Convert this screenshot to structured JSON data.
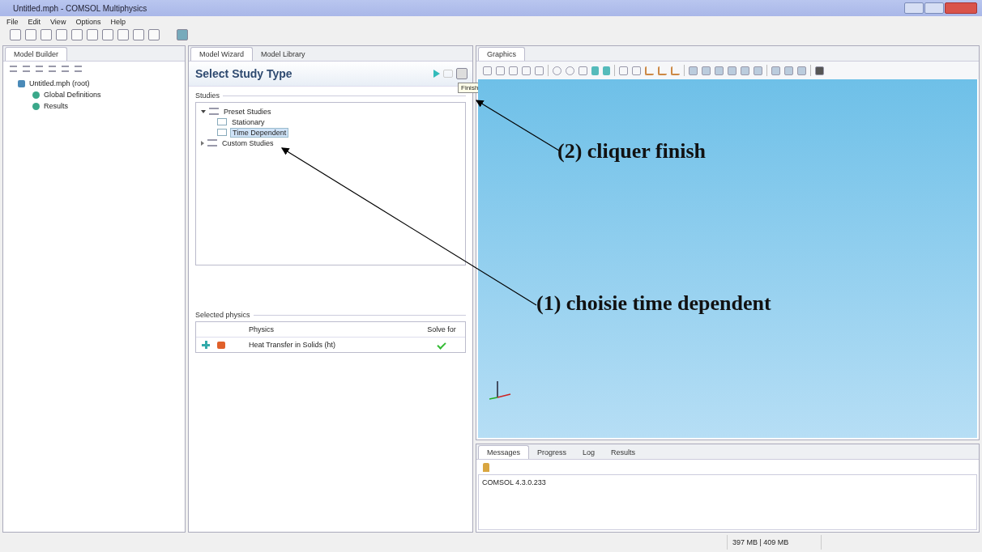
{
  "window": {
    "title": "Untitled.mph - COMSOL Multiphysics"
  },
  "menu": [
    "File",
    "Edit",
    "View",
    "Options",
    "Help"
  ],
  "model_builder": {
    "tab": "Model Builder",
    "tree": [
      {
        "label": "Untitled.mph (root)",
        "children": [
          {
            "label": "Global Definitions"
          },
          {
            "label": "Results"
          }
        ]
      }
    ]
  },
  "wizard": {
    "tabs": [
      {
        "label": "Model Wizard",
        "selected": true
      },
      {
        "label": "Model Library",
        "selected": false
      }
    ],
    "heading": "Select Study Type",
    "tooltip": "Finish",
    "studies_label": "Studies",
    "studies": [
      {
        "label": "Preset Studies",
        "expanded": true,
        "selected": false,
        "children": [
          {
            "label": "Stationary",
            "selected": false
          },
          {
            "label": "Time Dependent",
            "selected": true
          }
        ]
      },
      {
        "label": "Custom Studies",
        "expanded": false,
        "selected": false
      }
    ],
    "physics_label": "Selected physics",
    "columns": [
      "Physics",
      "Solve for"
    ],
    "physics": [
      {
        "name": "Heat Transfer in Solids (ht)",
        "solve_for": true
      }
    ]
  },
  "graphics": {
    "tab": "Graphics"
  },
  "messages": {
    "tabs": [
      {
        "label": "Messages",
        "selected": true
      },
      {
        "label": "Progress",
        "selected": false
      },
      {
        "label": "Log",
        "selected": false
      },
      {
        "label": "Results",
        "selected": false
      }
    ],
    "text": "COMSOL 4.3.0.233"
  },
  "status": {
    "memory": "397 MB | 409 MB"
  },
  "annotations": [
    {
      "label": "(2) cliquer finish"
    },
    {
      "label": "(1) choisie time dependent"
    }
  ]
}
